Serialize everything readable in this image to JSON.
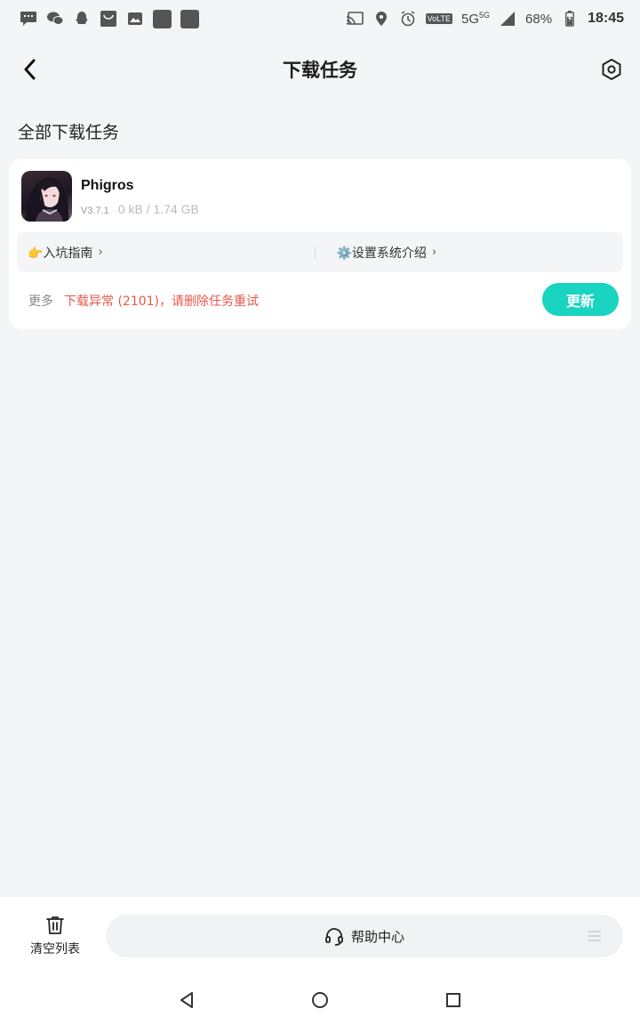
{
  "status_bar": {
    "battery": "68%",
    "time": "18:45",
    "network": "5G",
    "network_small": "5G",
    "volte": "VoLTE",
    "left_icons": [
      "message-icon",
      "wechat-icon",
      "qq-icon",
      "store-icon",
      "image-icon",
      "app-square-icon",
      "app-square-icon"
    ],
    "right_icons": [
      "cast-icon",
      "location-icon",
      "alarm-icon",
      "signal-icon",
      "battery-icon"
    ]
  },
  "header": {
    "title": "下载任务",
    "back_icon": "chevron-left-icon",
    "settings_icon": "hexagon-settings-icon"
  },
  "section_title": "全部下载任务",
  "task": {
    "app_name": "Phigros",
    "version": "V3.7.1",
    "size": "0 kB / 1.74 GB",
    "links": [
      {
        "label": "👉入坑指南",
        "icon": "pointing-hand-emoji"
      },
      {
        "label": "⚙️设置系统介绍",
        "icon": "gear-emoji"
      }
    ],
    "more_label": "更多",
    "error_text": "下载异常 (2101)，请删除任务重试",
    "update_label": "更新"
  },
  "bottom": {
    "clear_label": "清空列表",
    "help_label": "帮助中心"
  },
  "colors": {
    "accent": "#18d4c0",
    "error": "#e8574a",
    "background": "#f4f5f7"
  }
}
